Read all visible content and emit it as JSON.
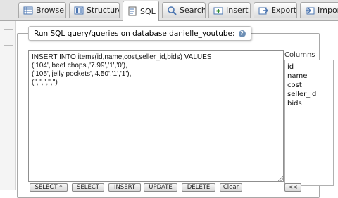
{
  "tabs": [
    {
      "label": "Browse",
      "icon": "browse-icon"
    },
    {
      "label": "Structure",
      "icon": "structure-icon"
    },
    {
      "label": "SQL",
      "icon": "sql-icon",
      "active": true
    },
    {
      "label": "Search",
      "icon": "search-icon"
    },
    {
      "label": "Insert",
      "icon": "insert-icon"
    },
    {
      "label": "Export",
      "icon": "export-icon"
    },
    {
      "label": "Import",
      "icon": "import-icon"
    }
  ],
  "query_panel": {
    "legend": "Run SQL query/queries on database danielle_youtube:",
    "help_icon": "help-icon",
    "sql_lines": [
      "INSERT INTO items(id,name,cost,seller_id,bids) VALUES",
      "('104','beef chops','7.99','1','0'),",
      "('105','jelly pockets','4.50','1','1'),",
      "('','','','','')"
    ]
  },
  "columns": {
    "label": "Columns",
    "items": [
      "id",
      "name",
      "cost",
      "seller_id",
      "bids"
    ]
  },
  "buttons": {
    "select_all": "SELECT *",
    "select": "SELECT",
    "insert": "INSERT",
    "update": "UPDATE",
    "delete": "DELETE",
    "clear": "Clear",
    "insert_column": "<<"
  },
  "colors": {
    "accent_icon": "#4a74b0",
    "tab_bar": "#e4e4e4"
  }
}
